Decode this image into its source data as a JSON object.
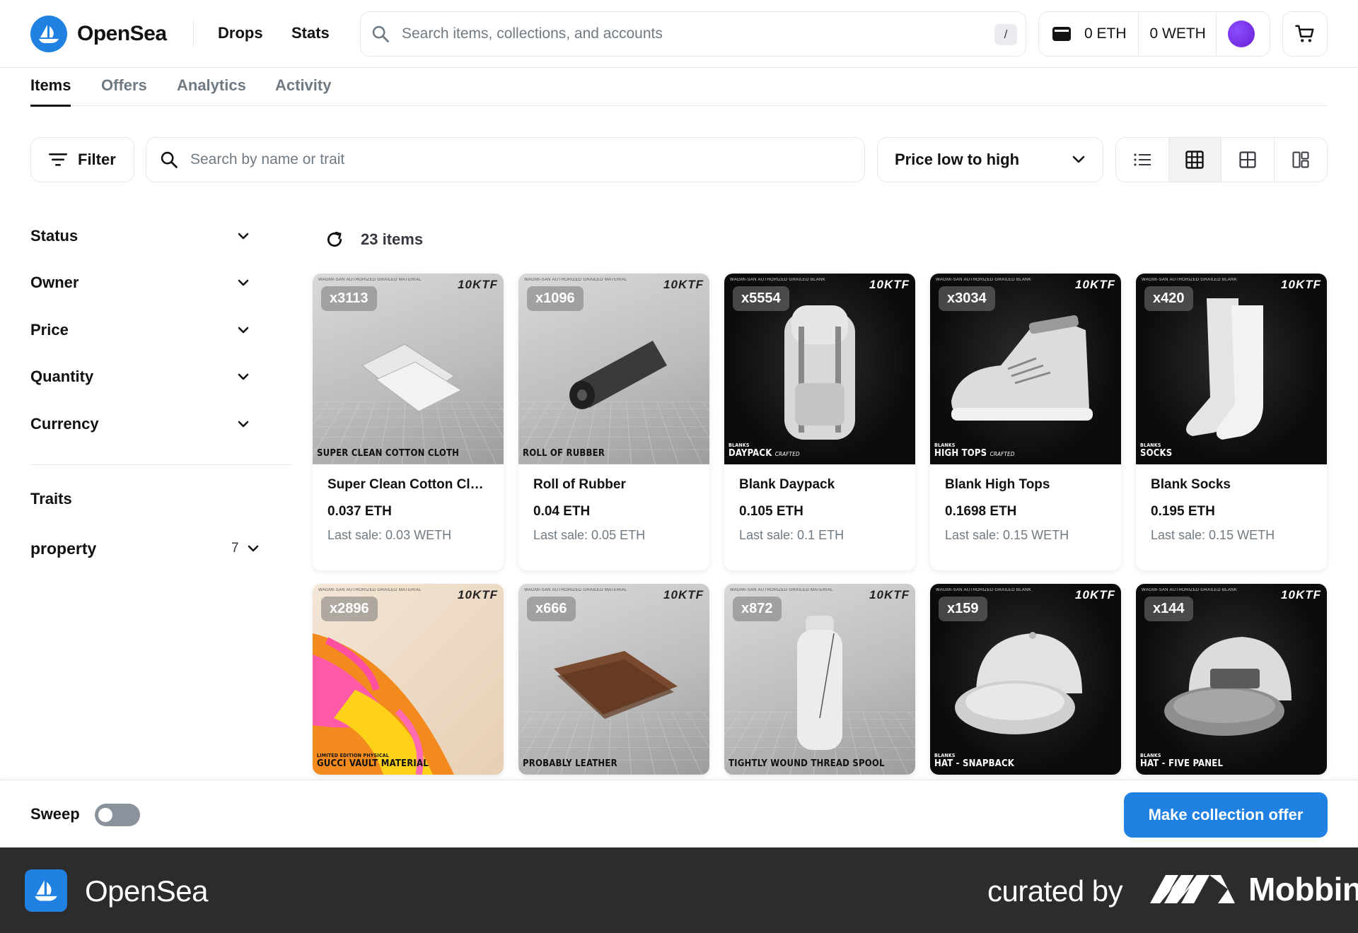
{
  "header": {
    "logo_text": "OpenSea",
    "nav": [
      "Drops",
      "Stats"
    ],
    "search_placeholder": "Search items, collections, and accounts",
    "search_shortcut": "/",
    "wallet_eth": "0 ETH",
    "wallet_weth": "0 WETH"
  },
  "tabs": [
    "Items",
    "Offers",
    "Analytics",
    "Activity"
  ],
  "toolbar": {
    "filter_label": "Filter",
    "search_placeholder": "Search by name or trait",
    "sort_label": "Price low to high"
  },
  "sidebar": {
    "filters": [
      "Status",
      "Owner",
      "Price",
      "Quantity",
      "Currency"
    ],
    "traits_title": "Traits",
    "property_label": "property",
    "property_count": "7"
  },
  "items_count": "23 items",
  "image_brand": "10KTF",
  "image_fine_print_light": "WAGMI-SAN AUTHORIZED GRAILED MATERIAL",
  "image_fine_print_dark": "WAGMI-SAN AUTHORIZED GRAILED BLANK",
  "image_tag_blanks": "BLANKS",
  "image_tag_limited": "LIMITED EDITION PHYSICAL",
  "image_tag_crafted": "CRAFTED",
  "cards": [
    {
      "qty": "x3113",
      "caption": "SUPER CLEAN COTTON CLOTH",
      "name": "Super Clean Cotton Cloth",
      "price": "0.037 ETH",
      "last": "Last sale: 0.03 WETH"
    },
    {
      "qty": "x1096",
      "caption": "ROLL OF RUBBER",
      "name": "Roll of Rubber",
      "price": "0.04 ETH",
      "last": "Last sale: 0.05 ETH"
    },
    {
      "qty": "x5554",
      "caption": "DAYPACK",
      "name": "Blank Daypack",
      "price": "0.105 ETH",
      "last": "Last sale: 0.1 ETH"
    },
    {
      "qty": "x3034",
      "caption": "HIGH TOPS",
      "name": "Blank High Tops",
      "price": "0.1698 ETH",
      "last": "Last sale: 0.15 WETH"
    },
    {
      "qty": "x420",
      "caption": "SOCKS",
      "name": "Blank Socks",
      "price": "0.195 ETH",
      "last": "Last sale: 0.15 WETH"
    },
    {
      "qty": "x2896",
      "caption": "GUCCI VAULT MATERIAL"
    },
    {
      "qty": "x666",
      "caption": "PROBABLY LEATHER"
    },
    {
      "qty": "x872",
      "caption": "TIGHTLY WOUND THREAD SPOOL"
    },
    {
      "qty": "x159",
      "caption": "HAT - SNAPBACK"
    },
    {
      "qty": "x144",
      "caption": "HAT - FIVE PANEL"
    }
  ],
  "action_bar": {
    "sweep_label": "Sweep",
    "offer_button": "Make collection offer"
  },
  "footer": {
    "brand": "OpenSea",
    "curated_by": "curated by",
    "curator": "Mobbin"
  },
  "colors": {
    "accent": "#2081e2",
    "text": "#121212",
    "muted": "#707a83",
    "border": "#e5e8eb",
    "footer_bg": "#2c2c2c"
  }
}
